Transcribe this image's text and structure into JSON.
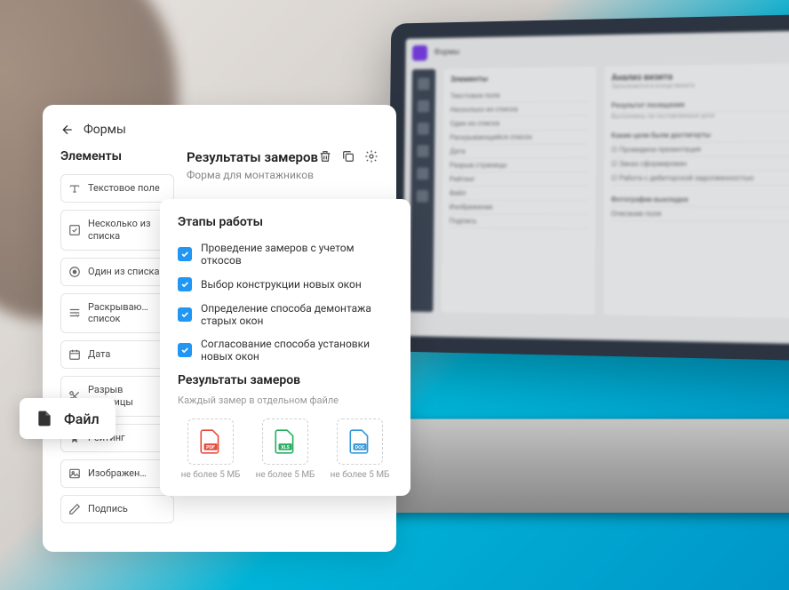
{
  "header": {
    "back_label": "Формы"
  },
  "sidebar": {
    "title": "Элементы",
    "items": [
      {
        "label": "Текстовое поле",
        "icon": "text"
      },
      {
        "label": "Несколько из списка",
        "icon": "checkbox"
      },
      {
        "label": "Один из списка",
        "icon": "radio"
      },
      {
        "label": "Раскрываю… список",
        "icon": "dropdown"
      },
      {
        "label": "Дата",
        "icon": "calendar"
      },
      {
        "label": "Разрыв страницы",
        "icon": "scissors"
      },
      {
        "label": "Рейтинг",
        "icon": "star"
      },
      {
        "label": "Изображен…",
        "icon": "image"
      },
      {
        "label": "Подпись",
        "icon": "pen"
      }
    ]
  },
  "content": {
    "title": "Результаты замеров",
    "subtitle": "Форма для монтажников"
  },
  "stage": {
    "title": "Этапы работы",
    "items": [
      "Проведение замеров с учетом откосов",
      "Выбор конструкции новых окон",
      "Определение способа демонтажа старых окон",
      "Согласование способа установки новых окон"
    ],
    "results_title": "Результаты замеров",
    "hint": "Каждый замер в отдельном файле",
    "files": [
      {
        "type": "PDF",
        "color": "#e74c3c",
        "limit": "не более 5 МБ"
      },
      {
        "type": "XLS",
        "color": "#27ae60",
        "limit": "не более 5 МБ"
      },
      {
        "type": "DOC",
        "color": "#3498db",
        "limit": "не более 5 МБ"
      }
    ]
  },
  "file_badge": {
    "label": "Файл"
  },
  "laptop": {
    "back": "Формы",
    "el_title": "Элементы",
    "main_title": "Анализ визита",
    "main_sub": "Заполняется в конце визита",
    "section1": "Результат посещения",
    "section1_sub": "Выполнены ли поставленные цели",
    "section2": "Какие цели были достигнуты",
    "goals": [
      "Проведена презентация",
      "Заказ сформирован",
      "Работа с дебиторской задолженностью"
    ],
    "section3": "Фотографии выкладки",
    "section4": "Описание поля",
    "items": [
      "Текстовое поле",
      "Несколько из списка",
      "Один из списка",
      "Раскрывающийся список",
      "Дата",
      "Разрыв страницы",
      "Рейтинг",
      "Файл",
      "Изображение",
      "Подпись"
    ]
  }
}
